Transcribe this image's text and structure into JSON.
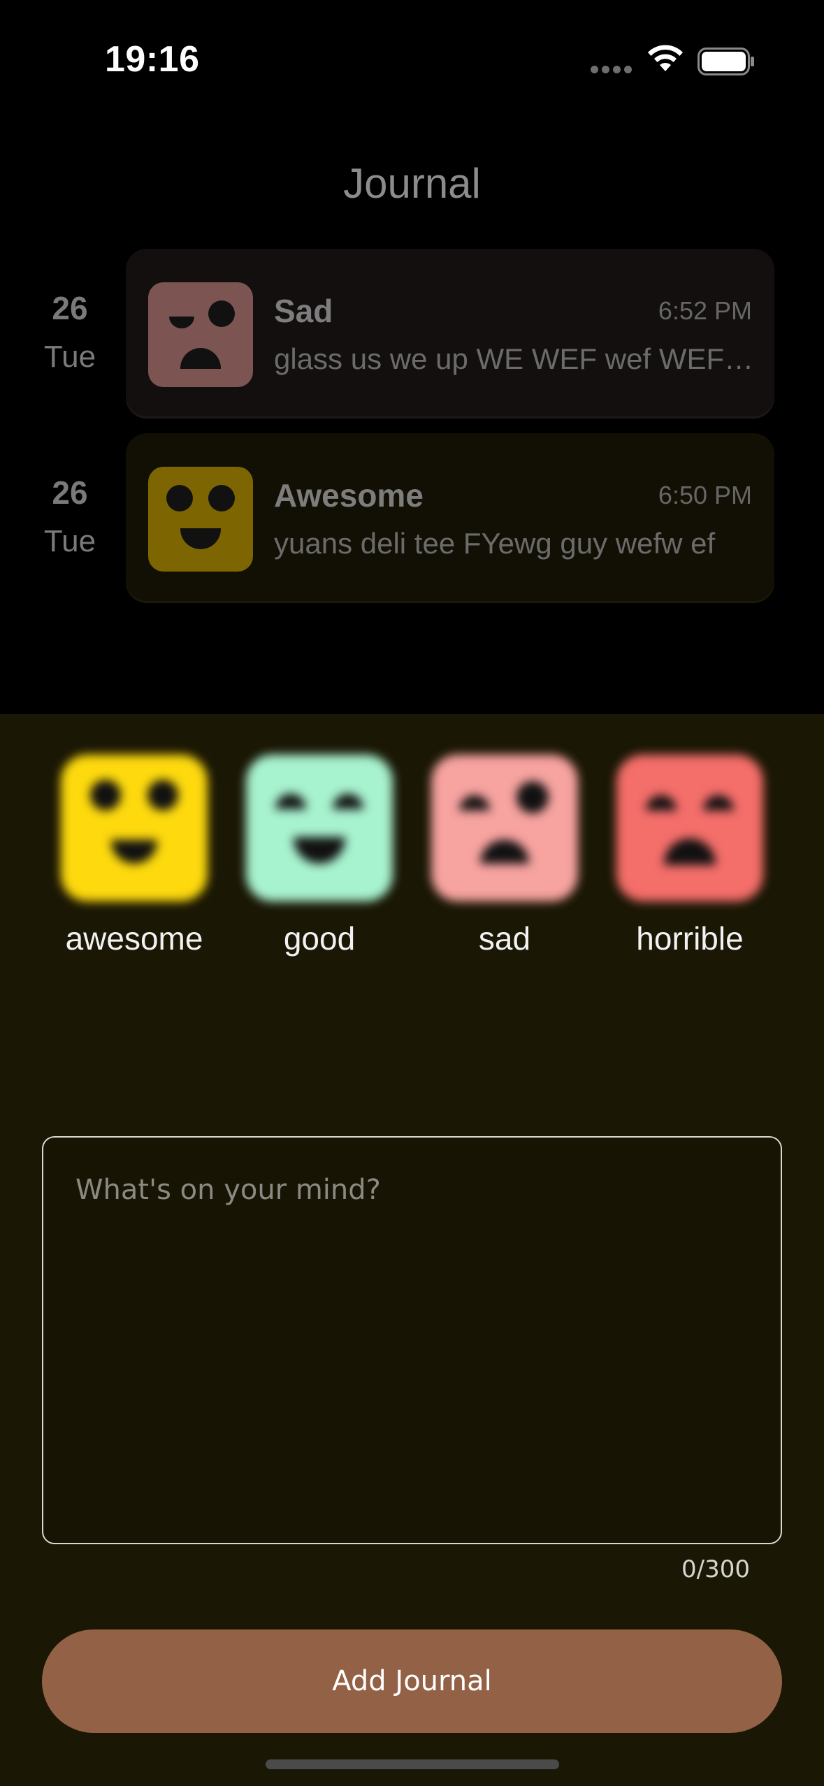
{
  "status_bar": {
    "time": "19:16"
  },
  "header": {
    "title": "Journal"
  },
  "entries": [
    {
      "day": "26",
      "weekday": "Tue",
      "mood": "Sad",
      "time": "6:52 PM",
      "text": "glass us we up WE WEF wef WEF we"
    },
    {
      "day": "26",
      "weekday": "Tue",
      "mood": "Awesome",
      "time": "6:50 PM",
      "text": "yuans deli tee FYewg guy wefw ef"
    }
  ],
  "moods": [
    {
      "label": "awesome",
      "color": "#fdd90e"
    },
    {
      "label": "good",
      "color": "#a7f2cf"
    },
    {
      "label": "sad",
      "color": "#f7a3a0"
    },
    {
      "label": "horrible",
      "color": "#f46e6a"
    }
  ],
  "composer": {
    "placeholder": "What's on your mind?",
    "counter": "0/300",
    "button_label": "Add Journal"
  },
  "colors": {
    "sad_card": "#140f0f",
    "awesome_card": "#121004",
    "sad_thumb": "#7c5552",
    "awesome_thumb": "#7d6601",
    "sheet": "#1a1705",
    "button": "#936145"
  }
}
